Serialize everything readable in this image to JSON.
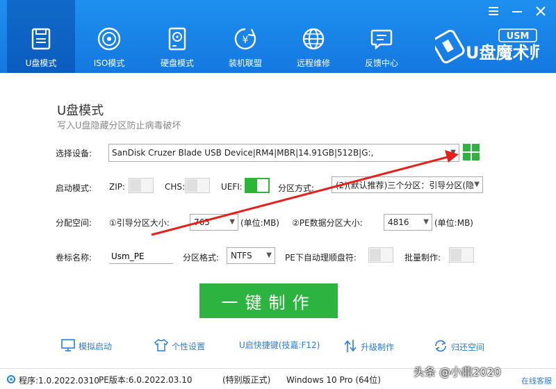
{
  "window": {
    "controls": {
      "menu_icon": "menu-icon",
      "minimize_icon": "minimize-icon",
      "close_icon": "close-icon"
    }
  },
  "nav": {
    "items": [
      {
        "label": "U盘模式",
        "icon": "usb-drive-icon",
        "active": true
      },
      {
        "label": "ISO模式",
        "icon": "disc-icon",
        "active": false
      },
      {
        "label": "硬盘模式",
        "icon": "hard-disk-icon",
        "active": false
      },
      {
        "label": "装机联盟",
        "icon": "yen-icon",
        "active": false
      },
      {
        "label": "远程维修",
        "icon": "globe-icon",
        "active": false
      },
      {
        "label": "反馈中心",
        "icon": "chat-icon",
        "active": false
      }
    ]
  },
  "logo": {
    "text_main": "U盘魔术师",
    "badge": "USM"
  },
  "main": {
    "title": "U盘模式",
    "subtitle": "写入U盘隐藏分区防止病毒破坏"
  },
  "device": {
    "label": "选择设备:",
    "value": "SanDisk Cruzer Blade USB Device|RM4|MBR|14.91GB|512B|G:,"
  },
  "boot": {
    "label": "启动模式:",
    "zip_label": "ZIP:",
    "zip_on": false,
    "chs_label": "CHS:",
    "chs_on": false,
    "uefi_label": "UEFI:",
    "uefi_on": true,
    "partition_method_label": "分区方式:",
    "partition_method_value": "(2)(默认推荐)三个分区：引导分区(隐"
  },
  "space": {
    "label": "分配空间:",
    "boot_size_label": "①引导分区大小:",
    "boot_size_value": "765",
    "unit1": "(单位:MB)",
    "pe_size_label": "②PE数据分区大小:",
    "pe_size_value": "4816",
    "unit2": "(单位:MB)"
  },
  "volume": {
    "label": "卷标名称:",
    "name_value": "Usm_PE",
    "format_label": "分区格式:",
    "format_value": "NTFS",
    "auto_sort_label": "PE下自动理顺盘符:",
    "auto_sort_on": false,
    "batch_label": "批量制作:",
    "batch_on": false
  },
  "make_button": "一键制作",
  "bottom_links": [
    {
      "label": "模拟启动",
      "icon": "monitor-icon"
    },
    {
      "label": "个性设置",
      "icon": "shirt-icon"
    },
    {
      "label": "U启快捷键(技嘉:F12)",
      "icon": ""
    },
    {
      "label": "升级制作",
      "icon": "upgrade-arrows-icon"
    },
    {
      "label": "归还空间",
      "icon": "restore-icon"
    }
  ],
  "status": {
    "program_version": "程序:1.0.2022.0310",
    "pe_version": "PE版本:6.0.2022.03.10",
    "edition": "(特别版正式)",
    "os": "Windows 10 Pro (64位)",
    "watermark": "头条 @小鼎2020",
    "corner": "在线客服"
  },
  "colors": {
    "header": "#1a84ea",
    "accent_green": "#2db440",
    "link_blue": "#2a7dd8",
    "annotation_red": "#e8201c"
  }
}
